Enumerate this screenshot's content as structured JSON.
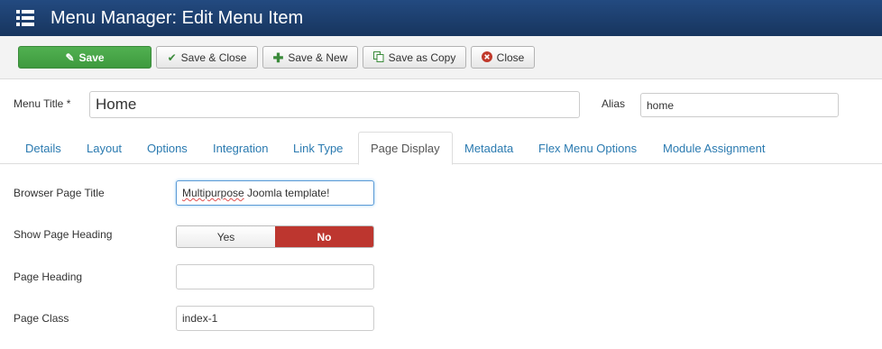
{
  "header": {
    "title": "Menu Manager: Edit Menu Item",
    "icon": "menu-list-icon"
  },
  "toolbar": {
    "save": "Save",
    "save_close": "Save & Close",
    "save_new": "Save & New",
    "save_copy": "Save as Copy",
    "close": "Close",
    "icons": {
      "save": "edit-icon",
      "save_close": "check-icon",
      "save_new": "plus-icon",
      "save_copy": "copy-icon",
      "close": "close-circle-icon"
    }
  },
  "form": {
    "menu_title_label": "Menu Title *",
    "menu_title_value": "Home",
    "alias_label": "Alias",
    "alias_value": "home"
  },
  "tabs": [
    "Details",
    "Layout",
    "Options",
    "Integration",
    "Link Type",
    "Page Display",
    "Metadata",
    "Flex Menu Options",
    "Module Assignment"
  ],
  "active_tab": "Page Display",
  "page_display": {
    "browser_title_label": "Browser Page Title",
    "browser_title_value_word1": "Multipurpose",
    "browser_title_value_rest": " Joomla template!",
    "show_heading_label": "Show Page Heading",
    "yes_label": "Yes",
    "no_label": "No",
    "selected": "No",
    "page_heading_label": "Page Heading",
    "page_heading_value": "",
    "page_class_label": "Page Class",
    "page_class_value": "index-1"
  },
  "colors": {
    "header_bg": "#1c3d6b",
    "save_green": "#46a546",
    "link_blue": "#2a7ab0",
    "no_red": "#bd362f"
  }
}
